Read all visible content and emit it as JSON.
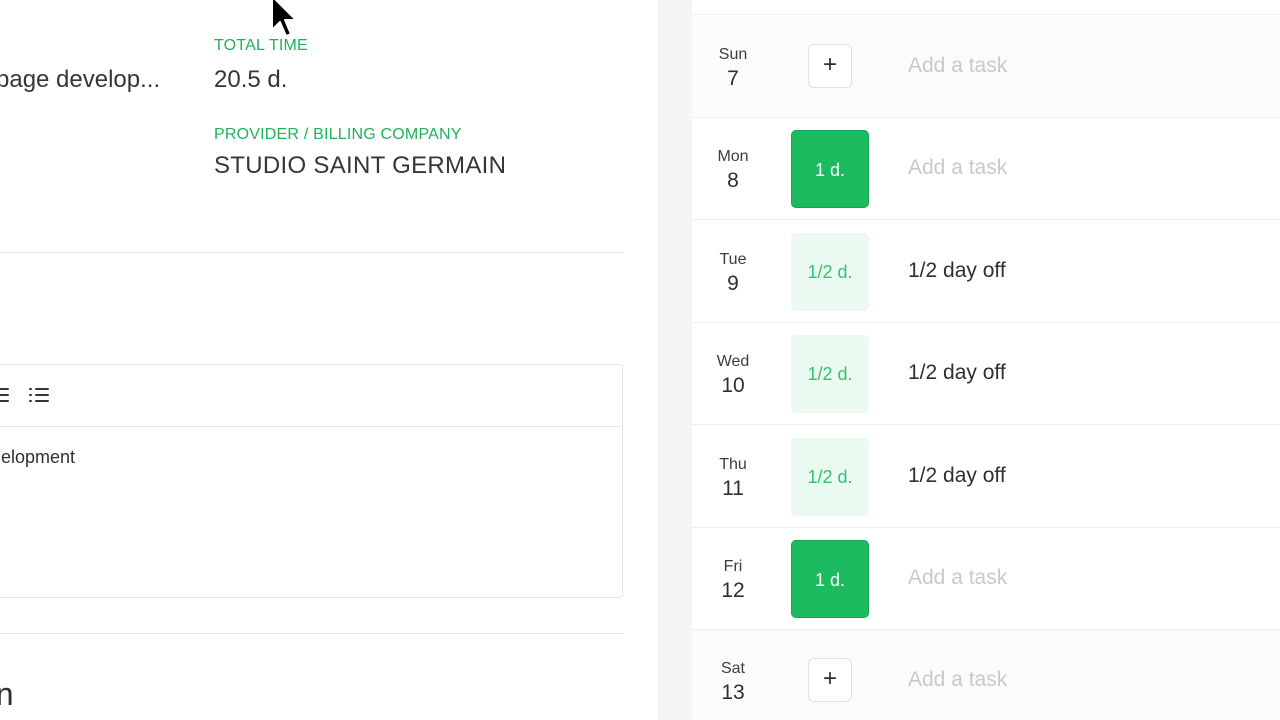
{
  "project": {
    "name": "page develop...",
    "total_time_label": "TOTAL TIME",
    "total_time_value": "20.5 d.",
    "provider_label": "PROVIDER / BILLING COMPANY",
    "provider_value": "STUDIO SAINT GERMAIN"
  },
  "editor": {
    "content": "elopment"
  },
  "section": {
    "heading": "on"
  },
  "calendar": {
    "days": [
      {
        "dow": "Sun",
        "num": "7",
        "allocation": "+",
        "kind": "add",
        "task": "Add a task",
        "task_kind": "placeholder"
      },
      {
        "dow": "Mon",
        "num": "8",
        "allocation": "1 d.",
        "kind": "full",
        "task": "Add a task",
        "task_kind": "placeholder"
      },
      {
        "dow": "Tue",
        "num": "9",
        "allocation": "1/2 d.",
        "kind": "half",
        "task": "1/2 day off",
        "task_kind": "filled"
      },
      {
        "dow": "Wed",
        "num": "10",
        "allocation": "1/2 d.",
        "kind": "half",
        "task": "1/2 day off",
        "task_kind": "filled"
      },
      {
        "dow": "Thu",
        "num": "11",
        "allocation": "1/2 d.",
        "kind": "half",
        "task": "1/2 day off",
        "task_kind": "filled"
      },
      {
        "dow": "Fri",
        "num": "12",
        "allocation": "1 d.",
        "kind": "full",
        "task": "Add a task",
        "task_kind": "placeholder"
      },
      {
        "dow": "Sat",
        "num": "13",
        "allocation": "+",
        "kind": "add",
        "task": "Add a task",
        "task_kind": "placeholder"
      }
    ]
  },
  "colors": {
    "accent_green": "#1dbb60",
    "half_day_bg": "#eafaf0",
    "label_green": "#1fb25a"
  },
  "icons": [
    "align-icon",
    "bullet-list-icon",
    "plus-icon",
    "mouse-cursor-icon"
  ]
}
